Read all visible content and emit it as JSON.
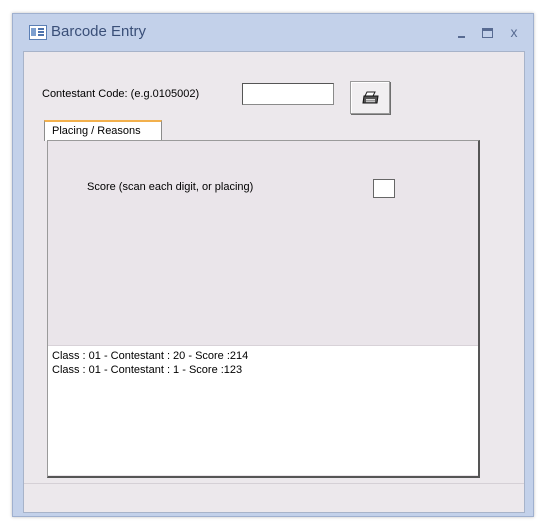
{
  "window": {
    "title": "Barcode Entry",
    "icon": "form-icon",
    "controls": [
      "minimize-icon",
      "maximize-icon",
      "close-icon"
    ],
    "close_glyph": "x"
  },
  "form": {
    "code_label": "Contestant Code: (e.g.0105002)",
    "code_value": "",
    "print_button_icon": "printer-icon"
  },
  "tabs": [
    {
      "label": "Placing / Reasons",
      "selected": true
    }
  ],
  "panel": {
    "score_label": "Score (scan each digit, or placing)",
    "score_value": ""
  },
  "results": [
    "Class : 01 - Contestant : 20 - Score :214",
    "Class : 01 - Contestant : 1 - Score :123"
  ]
}
